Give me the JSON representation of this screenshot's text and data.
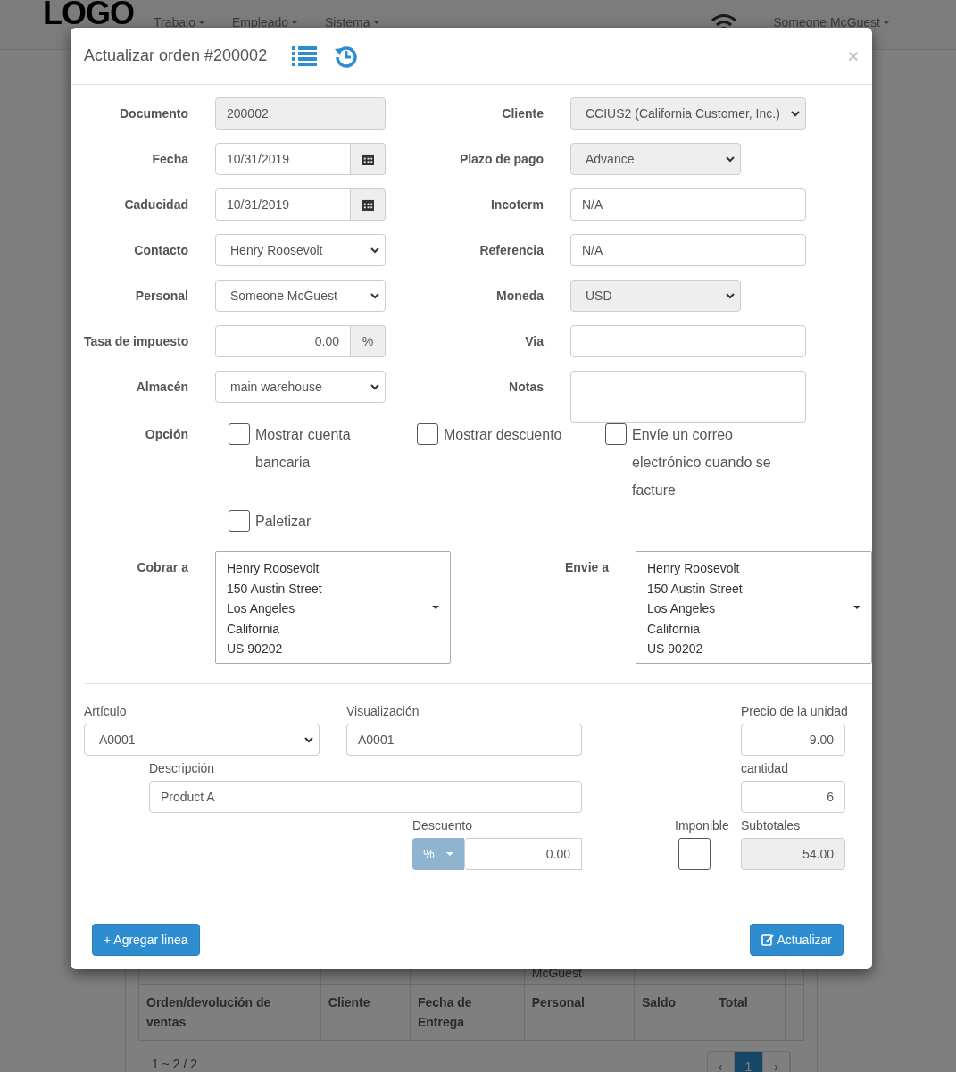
{
  "navbar": {
    "logo": "LOGO",
    "menus": [
      {
        "label": "Trabajo"
      },
      {
        "label": "Empleado"
      },
      {
        "label": "Sistema"
      }
    ],
    "user": "Someone McGuest"
  },
  "background_table": {
    "partial_cell": "McGuest",
    "columns": [
      "Orden/devolución de ventas",
      "Cliente",
      "Fecha de Entrega",
      "Personal",
      "Saldo",
      "Total"
    ],
    "summary": "1 ~ 2 / 2",
    "pages": [
      {
        "label": "‹",
        "selected": false
      },
      {
        "label": "1",
        "selected": true
      },
      {
        "label": "›",
        "selected": false
      }
    ]
  },
  "modal": {
    "title": "Actualizar orden #200002",
    "close": "×",
    "rows": [
      {
        "left": {
          "label": "Documento",
          "kind": "text",
          "value": "200002",
          "disabled": true
        },
        "right": {
          "label": "Cliente",
          "kind": "select",
          "value": "CCIUS2 (California Customer, Inc.)",
          "disabled": true
        }
      },
      {
        "left": {
          "label": "Fecha",
          "kind": "date",
          "value": "10/31/2019",
          "disabled": false
        },
        "right": {
          "label": "Plazo de pago",
          "kind": "select",
          "value": "Advance",
          "disabled": true
        }
      },
      {
        "left": {
          "label": "Caducidad",
          "kind": "date",
          "value": "10/31/2019",
          "disabled": false
        },
        "right": {
          "label": "Incoterm",
          "kind": "text",
          "value": "N/A",
          "disabled": false
        }
      },
      {
        "left": {
          "label": "Contacto",
          "kind": "select",
          "value": "Henry Roosevolt",
          "disabled": false
        },
        "right": {
          "label": "Referencia",
          "kind": "text",
          "value": "N/A",
          "disabled": false
        }
      },
      {
        "left": {
          "label": "Personal",
          "kind": "select",
          "value": "Someone McGuest",
          "disabled": false
        },
        "right": {
          "label": "Moneda",
          "kind": "select",
          "value": "USD",
          "disabled": true
        }
      },
      {
        "left": {
          "label": "Tasa de impuesto",
          "kind": "percent",
          "value": "0.00",
          "unit": "%",
          "disabled": false
        },
        "right": {
          "label": "Via",
          "kind": "text",
          "disabled": false
        }
      },
      {
        "left": {
          "label": "Almacén",
          "kind": "select",
          "value": "main warehouse",
          "disabled": false
        },
        "right": {
          "label": "Notas",
          "kind": "textarea",
          "disabled": false
        }
      }
    ],
    "options": {
      "label": "Opción",
      "checkboxes": [
        {
          "label": "Mostrar cuenta bancaria",
          "checked": false
        },
        {
          "label": "Mostrar descuento",
          "checked": false
        },
        {
          "label": "Envíe un correo electrónico cuando se facture",
          "checked": false
        },
        {
          "label": "Paletizar",
          "checked": false
        }
      ]
    },
    "addresses": [
      {
        "label": "Cobrar a",
        "lines": [
          "Henry Roosevolt",
          "150 Austin Street",
          "Los Angeles",
          "California",
          "US 90202"
        ]
      },
      {
        "label": "Envie a",
        "lines": [
          "Henry Roosevolt",
          "150 Austin Street",
          "Los Angeles",
          "California",
          "US 90202"
        ]
      }
    ],
    "item": {
      "article": {
        "label": "Artículo",
        "value": "A0001"
      },
      "display": {
        "label": "Visualización",
        "value": "A0001"
      },
      "unit_price": {
        "label": "Precio de la unidad",
        "value": "9.00"
      },
      "description": {
        "label": "Descripción",
        "value": "Product A"
      },
      "quantity": {
        "label": "cantidad",
        "value": "6"
      },
      "discount": {
        "label": "Descuento",
        "type": "%",
        "value": "0.00"
      },
      "taxable": {
        "label": "Imponible",
        "checked": false
      },
      "subtotal": {
        "label": "Subtotales",
        "value": "54.00"
      }
    },
    "footer": {
      "add_line": "+ Agregar linea",
      "update": "Actualizar"
    }
  }
}
